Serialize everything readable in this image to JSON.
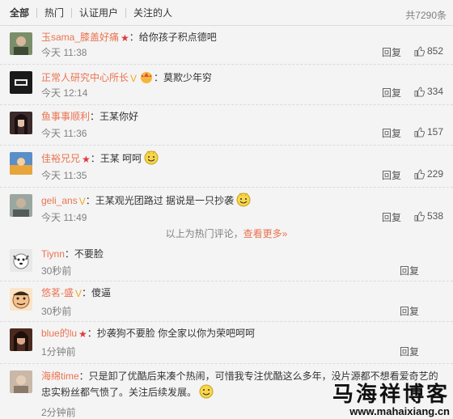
{
  "tabs": [
    "全部",
    "热门",
    "认证用户",
    "关注的人"
  ],
  "total": "共7290条",
  "reply_label": "回复",
  "divider": {
    "text": "以上为热门评论，",
    "more": "查看更多»"
  },
  "comments": [
    {
      "name": "玉sama_膝盖好痛",
      "badge": "★",
      "text": "：给你孩子积点德吧",
      "time": "今天 11:38",
      "likes": "852"
    },
    {
      "name": "正常人研究中心所长",
      "badge": "V",
      "text": "：莫欺少年穷",
      "time": "今天 12:14",
      "likes": "334"
    },
    {
      "name": "鱼事事顺利",
      "badge": "",
      "text": "：王某你好",
      "time": "今天 11:36",
      "likes": "157"
    },
    {
      "name": "佳裕兄兄",
      "badge": "★",
      "text": "：王某 呵呵",
      "time": "今天 11:35",
      "likes": "229"
    },
    {
      "name": "geli_ans",
      "badge": "V",
      "text": "：王某观光团路过 据说是一只抄袭",
      "time": "今天 11:49",
      "likes": "538"
    },
    {
      "name": "Tiynn",
      "badge": "",
      "text": "：不要脸",
      "time": "30秒前",
      "likes": ""
    },
    {
      "name": "悠茗-盛",
      "badge": "V",
      "text": "：傻逼",
      "time": "30秒前",
      "likes": ""
    },
    {
      "name": "blue的lu",
      "badge": "★",
      "text": "：抄袭狗不要脸 你全家以你为荣吧呵呵",
      "time": "1分钟前",
      "likes": ""
    },
    {
      "name": "海绵time",
      "badge": "",
      "text": "：只是卸了优酷后来凑个热闹，可惜我专注优酷这么多年，没片源都不想看爱奇艺的忠实粉丝都气愤了。关注后续发展。",
      "time": "2分钟前",
      "likes": ""
    }
  ],
  "watermark": {
    "cn": "马海祥博客",
    "url": "www.mahaixiang.cn"
  },
  "icons": {
    "like": "thumbs-up-icon",
    "emoji": "smiley-face-icon"
  }
}
